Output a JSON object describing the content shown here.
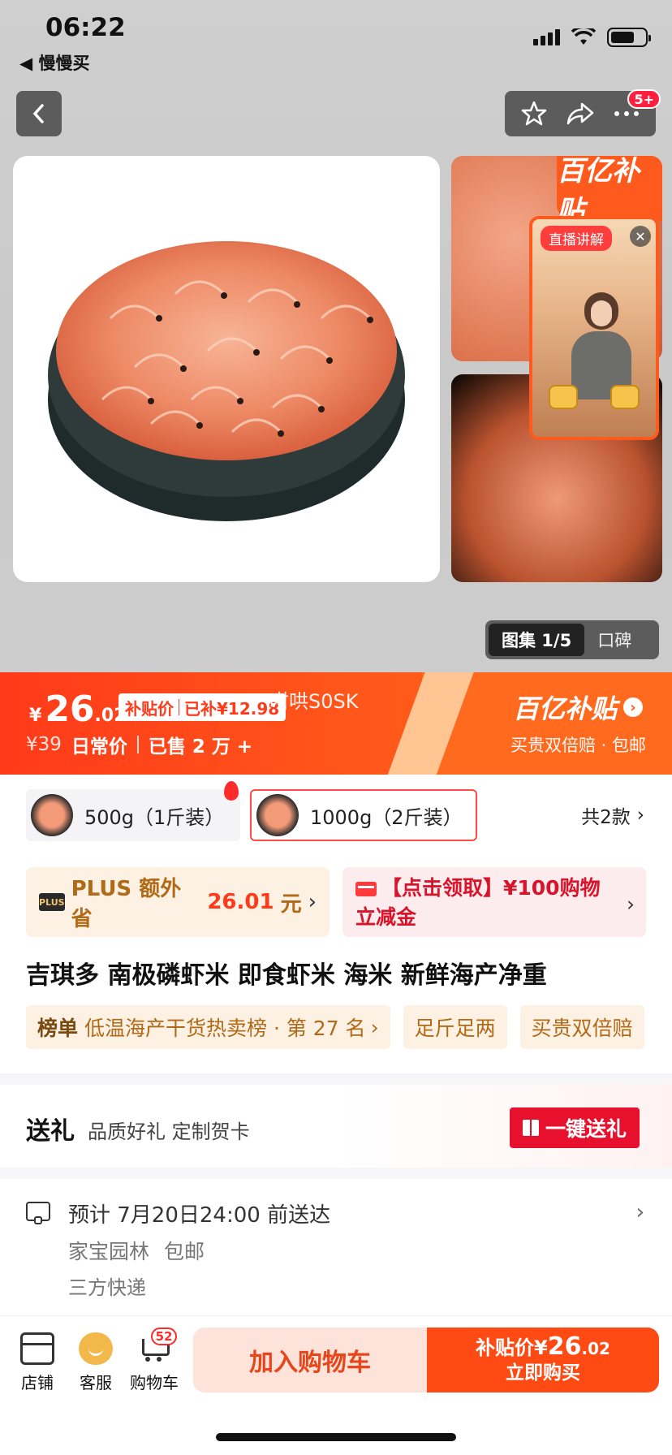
{
  "status_bar": {
    "time": "06:22",
    "back_app": "◀ 慢慢买"
  },
  "nav": {
    "notification_badge": "5+"
  },
  "gallery": {
    "brand_logo": "百亿补贴",
    "live": {
      "tag": "直播讲解"
    },
    "switch": {
      "active": "图集 1/5",
      "inactive": "口碑"
    }
  },
  "price_banner": {
    "currency": "¥",
    "price_int": "26",
    "price_dec": ".02",
    "subsidy_label": "补贴价",
    "subsidy_saved": "已补¥12.98",
    "overlay_code": "咁哄S0SK",
    "original_price": "¥39",
    "daily_price_label": "日常价",
    "sold": "已售 2 万 +",
    "brand": "百亿补贴",
    "brand_note": "买贵双倍赔 · 包邮"
  },
  "variants": {
    "items": [
      {
        "label": "500g（1斤装）"
      },
      {
        "label": "1000g（2斤装）"
      }
    ],
    "total": "共2款"
  },
  "promos": {
    "plus": {
      "badge": "PLUS",
      "prefix": "PLUS 额外省 ",
      "amount": "26.01",
      "suffix": "元"
    },
    "coupon": {
      "text": "【点击领取】¥100购物立减金"
    }
  },
  "product": {
    "title": "吉琪多 南极磷虾米 即食虾米 海米 新鲜海产净重"
  },
  "tags": {
    "ranking_label": "榜单",
    "ranking_text": "低温海产干货热卖榜 · 第 27 名",
    "tag2": "足斤足两",
    "tag3": "买贵双倍赔"
  },
  "gift": {
    "title": "送礼",
    "subtitle": "品质好礼 定制贺卡",
    "button": "一键送礼"
  },
  "delivery": {
    "eta": "预计 7月20日24:00 前送达",
    "location": "家宝园林",
    "shipping": "包邮",
    "carrier": "三方快递"
  },
  "bottom_bar": {
    "store": "店铺",
    "service": "客服",
    "cart": "购物车",
    "cart_count": "52",
    "add_to_cart": "加入购物车",
    "buy_label": "补贴价",
    "buy_currency": "¥",
    "buy_int": "26",
    "buy_dec": ".02",
    "buy_now": "立即购买"
  },
  "colors": {
    "accent": "#ff4a14",
    "subsidy_red": "#e8112d",
    "plus_gold": "#b06a18"
  }
}
